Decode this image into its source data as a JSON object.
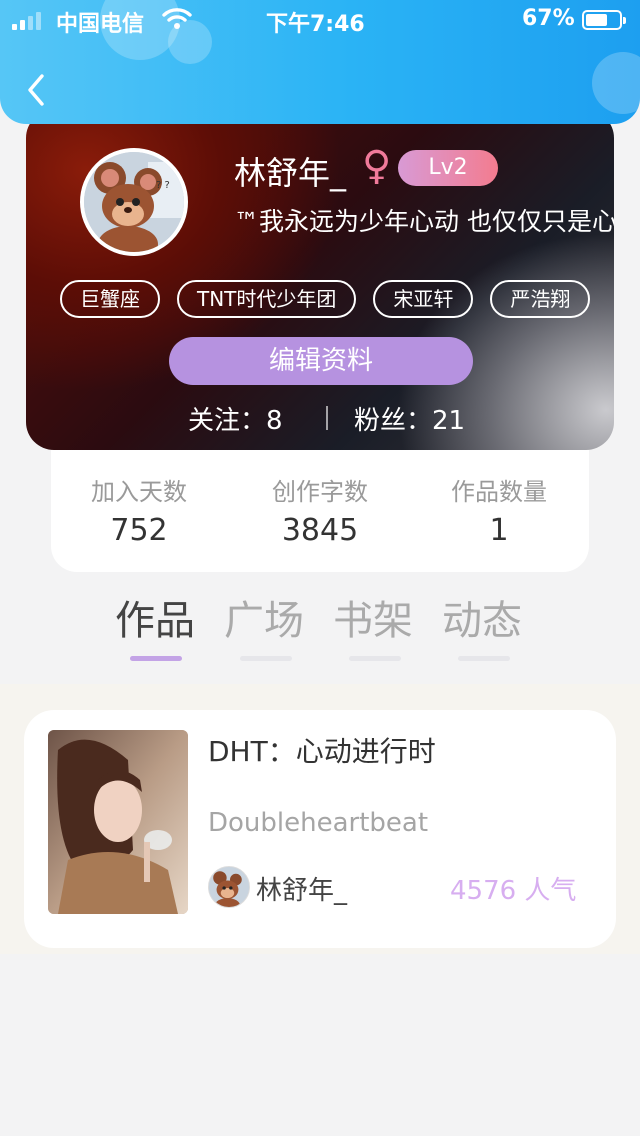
{
  "status_bar": {
    "carrier": "中国电信",
    "time": "下午7:46",
    "battery": "67%",
    "battery_level": 0.67
  },
  "nav": {
    "back_icon": "chevron-left-icon"
  },
  "profile": {
    "username": "林舒年_",
    "gender_symbol": "♀",
    "level": "Lv2",
    "bio": "™我永远为少年心动 也仅仅只是心动",
    "tags": [
      "巨蟹座",
      "TNT时代少年团",
      "宋亚轩",
      "严浩翔"
    ],
    "edit_button": "编辑资料",
    "follow_label": "关注：",
    "follow_count": "8",
    "fans_label": "粉丝：",
    "fans_count": "21"
  },
  "stats": [
    {
      "label": "加入天数",
      "value": "752"
    },
    {
      "label": "创作字数",
      "value": "3845"
    },
    {
      "label": "作品数量",
      "value": "1"
    }
  ],
  "tabs": [
    {
      "label": "作品",
      "active": true
    },
    {
      "label": "广场",
      "active": false
    },
    {
      "label": "书架",
      "active": false
    },
    {
      "label": "动态",
      "active": false
    }
  ],
  "works": [
    {
      "title": "DHT：心动进行时",
      "subtitle": "Doubleheartbeat",
      "author": "林舒年_",
      "popularity": "4576 人气"
    }
  ],
  "colors": {
    "header_accent": "#2ab3f5",
    "edit_button": "#b692e0",
    "level_badge_start": "#d89ad5",
    "level_badge_end": "#f37c8f",
    "popularity": "#d7aef0",
    "tab_indicator": "#c3a3e6"
  }
}
